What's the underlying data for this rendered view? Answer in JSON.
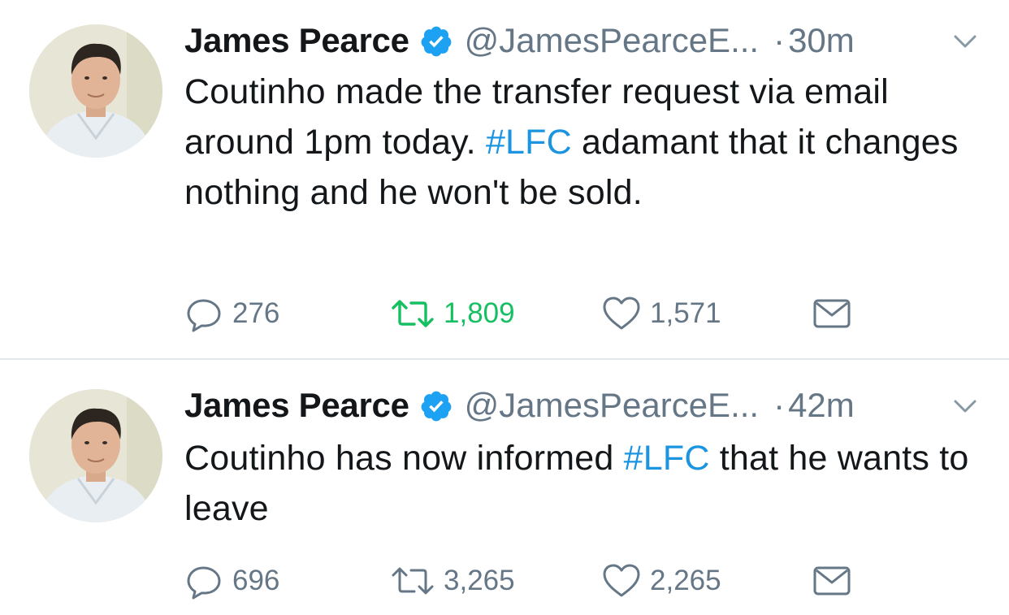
{
  "tweets": [
    {
      "author_name": "James Pearce",
      "handle": "@JamesPearceE...",
      "separator": "·",
      "time": "30m",
      "text_parts": [
        "Coutinho made the transfer request via email around 1pm today. ",
        "#LFC",
        " adamant that it changes nothing and he won't be sold."
      ],
      "replies": "276",
      "retweets": "1,809",
      "likes": "1,571",
      "retweeted": true
    },
    {
      "author_name": "James Pearce",
      "handle": "@JamesPearceE...",
      "separator": "·",
      "time": "42m",
      "text_parts": [
        "Coutinho has now informed ",
        "#LFC",
        " that he wants to leave"
      ],
      "replies": "696",
      "retweets": "3,265",
      "likes": "2,265",
      "retweeted": false
    }
  ],
  "colors": {
    "text": "#14171a",
    "secondary": "#657786",
    "hashtag": "#1b95e0",
    "verified": "#1da1f2",
    "retweet_active": "#17bf63",
    "divider": "#e1e8ed"
  },
  "icons": [
    "verified-badge-icon",
    "chevron-down-icon",
    "reply-icon",
    "retweet-icon",
    "like-icon",
    "direct-message-icon"
  ]
}
